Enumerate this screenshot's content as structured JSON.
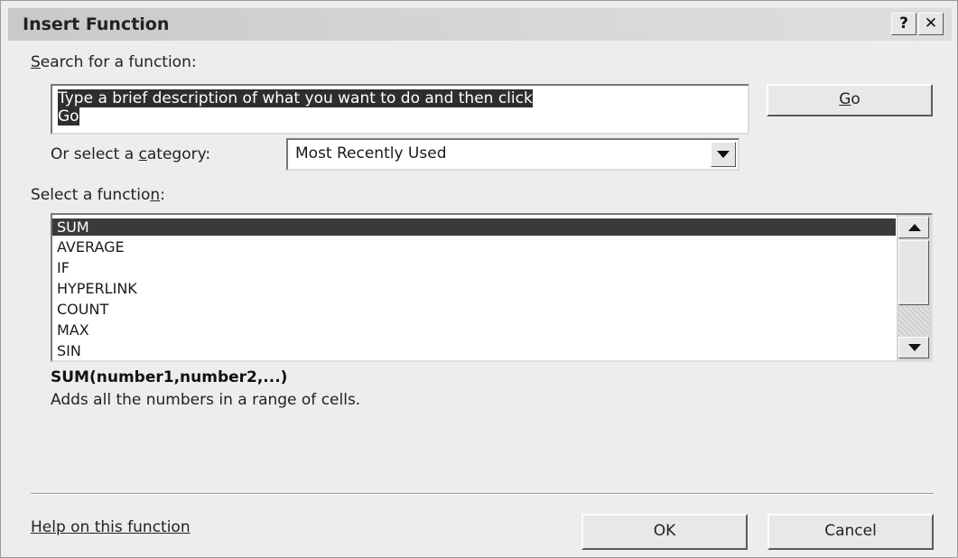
{
  "window": {
    "title": "Insert Function",
    "help_button": "?",
    "close_button": "✕"
  },
  "search": {
    "label_prefix": "",
    "label_mnemonic": "S",
    "label_rest": "earch for a function:",
    "value_line1": "Type a brief description of what you want to do and then click",
    "value_line2": "Go",
    "go_mnemonic": "G",
    "go_rest": "o"
  },
  "category": {
    "label_prefix": "Or select a ",
    "label_mnemonic": "c",
    "label_rest": "ategory:",
    "selected": "Most Recently Used"
  },
  "functions": {
    "label_prefix": "Select a functio",
    "label_mnemonic": "n",
    "label_rest": ":",
    "items": [
      "SUM",
      "AVERAGE",
      "IF",
      "HYPERLINK",
      "COUNT",
      "MAX",
      "SIN"
    ],
    "selected_index": 0,
    "signature": "SUM(number1,number2,...)",
    "description": "Adds all the numbers in a range of cells."
  },
  "footer": {
    "help_link": "Help on this function",
    "ok_label": "OK",
    "cancel_label": "Cancel"
  },
  "colors": {
    "selection": "#3a3a3a",
    "dialog_bg": "#ededed"
  }
}
